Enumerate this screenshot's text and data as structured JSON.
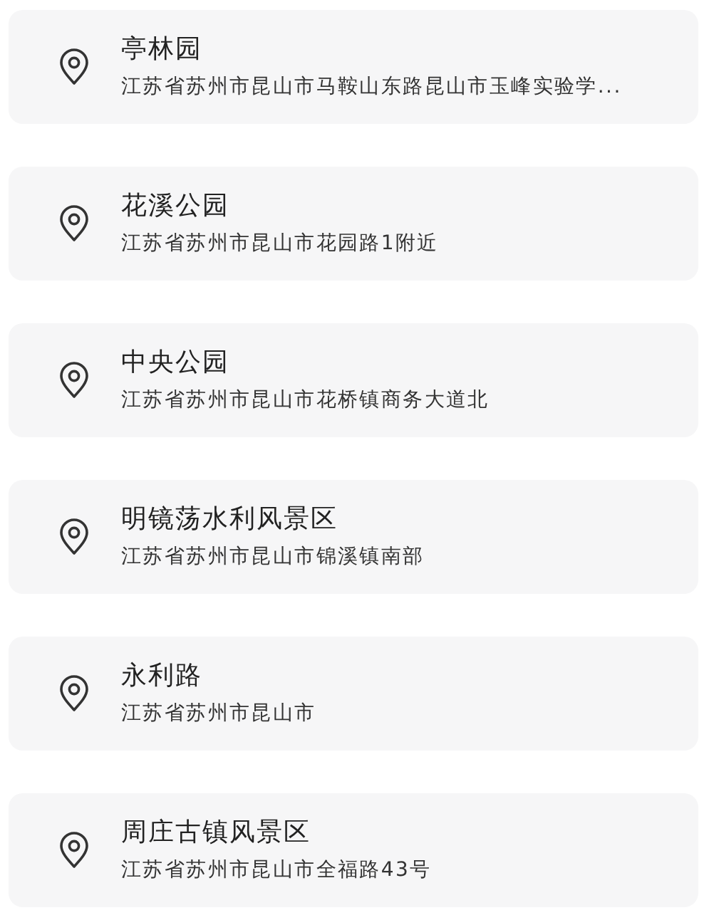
{
  "places": [
    {
      "name": "亭林园",
      "address": "江苏省苏州市昆山市马鞍山东路昆山市玉峰实验学..."
    },
    {
      "name": "花溪公园",
      "address": "江苏省苏州市昆山市花园路1附近"
    },
    {
      "name": "中央公园",
      "address": "江苏省苏州市昆山市花桥镇商务大道北"
    },
    {
      "name": "明镜荡水利风景区",
      "address": "江苏省苏州市昆山市锦溪镇南部"
    },
    {
      "name": "永利路",
      "address": "江苏省苏州市昆山市"
    },
    {
      "name": "周庄古镇风景区",
      "address": "江苏省苏州市昆山市全福路43号"
    }
  ]
}
